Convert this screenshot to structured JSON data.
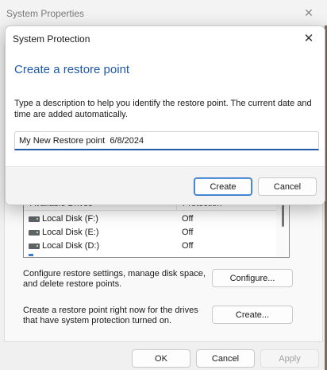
{
  "system_properties": {
    "title": "System Properties",
    "close_glyph": "✕",
    "drives": {
      "header": [
        "Available Drives",
        "Protection"
      ],
      "rows": [
        {
          "name": "Local Disk (F:)",
          "protection": "Off"
        },
        {
          "name": "Local Disk (E:)",
          "protection": "Off"
        },
        {
          "name": "Local Disk (D:)",
          "protection": "Off"
        }
      ]
    },
    "configure_text": "Configure restore settings, manage disk space, and delete restore points.",
    "configure_button": "Configure...",
    "create_text": "Create a restore point right now for the drives that have system protection turned on.",
    "create_button": "Create...",
    "ok_button": "OK",
    "cancel_button": "Cancel",
    "apply_button": "Apply"
  },
  "dialog": {
    "title": "System Protection",
    "close_glyph": "✕",
    "heading": "Create a restore point",
    "description": "Type a description to help you identify the restore point. The current date and time are added automatically.",
    "input_value": "My New Restore point  6/8/2024",
    "create_button": "Create",
    "cancel_button": "Cancel"
  },
  "icons": {
    "drive": "hard-drive-icon",
    "close": "close-icon"
  },
  "colors": {
    "accent": "#1e5aa8",
    "primary_button_border": "#2f6fbf"
  }
}
